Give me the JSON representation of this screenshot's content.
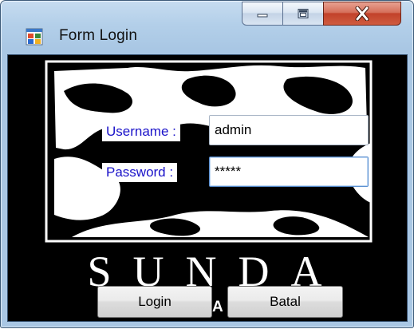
{
  "window": {
    "title": "Form Login",
    "icon": "windows-form-app-icon"
  },
  "caption_buttons": {
    "minimize": "minimize-icon",
    "maximize": "maximize-icon",
    "close": "close-icon"
  },
  "form": {
    "username_label": "Username :",
    "username_value": "admin",
    "password_label": "Password :",
    "password_value": "*****"
  },
  "brand": {
    "logo_text": "SUNDA",
    "stray_letter": "A"
  },
  "buttons": {
    "login": "Login",
    "cancel": "Batal"
  },
  "colors": {
    "label_text": "#1a12c9",
    "background_art": "#000000",
    "art_foreground": "#ffffff",
    "close_button": "#c2412a"
  }
}
